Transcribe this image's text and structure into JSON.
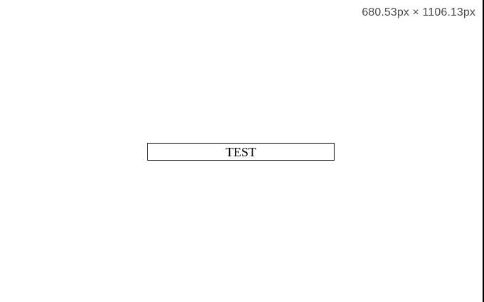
{
  "viewport_readout": "680.53px × 1106.13px",
  "test_box": {
    "label": "TEST"
  },
  "colors": {
    "background": "#ffffff",
    "border": "#000000",
    "readout_text": "#4a4a4a"
  }
}
